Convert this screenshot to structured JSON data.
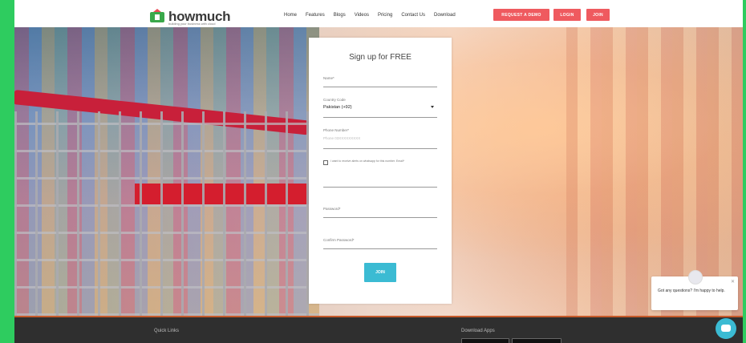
{
  "brand": {
    "name": "howmuch",
    "tagline": "building your business with cloud",
    "colors": {
      "accent_red": "#ef5a5f",
      "accent_teal": "#3bbbd3",
      "frame_green": "#2ecc5f"
    }
  },
  "nav": {
    "items": [
      "Home",
      "Features",
      "Blogs",
      "Videos",
      "Pricing",
      "Contact Us",
      "Download"
    ],
    "request_demo": "REQUEST A DEMO",
    "login": "LOGIN",
    "join": "JOIN"
  },
  "form": {
    "title": "Sign up for FREE",
    "name_label": "Name*",
    "country_label": "Country Code",
    "country_value": "Pakistan (+92)",
    "phone_label": "Phone Number*",
    "phone_placeholder": "Phone 03XXXXXXXXX",
    "checkbox_text": "I want to receive alerts on whatsapp for this number. Email*",
    "password_label": "Password*",
    "confirm_label": "Confirm Password*",
    "join_button": "JOIN"
  },
  "footer": {
    "quick_links": "Quick Links",
    "download_apps": "Download Apps"
  },
  "chat": {
    "message": "Got any questions? I'm happy to help.",
    "close_icon": "close-icon",
    "launcher_icon": "chat-bubble-icon"
  }
}
